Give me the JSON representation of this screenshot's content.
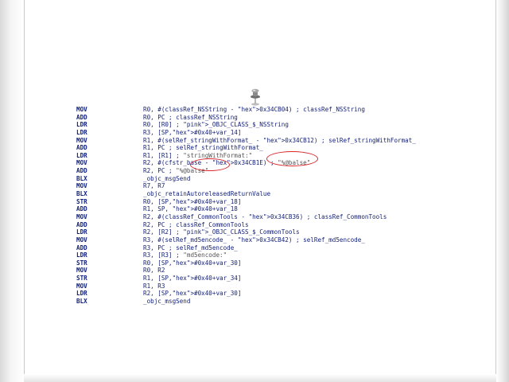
{
  "listing": [
    {
      "op": "MOV",
      "args": "R0, #(classRef_NSString - 0x34CB04) ; classRef_NSString"
    },
    {
      "op": "ADD",
      "args": "R0, PC ; classRef_NSString"
    },
    {
      "op": "LDR",
      "args": "R0, [R0] ; _OBJC_CLASS_$_NSString"
    },
    {
      "op": "LDR",
      "args": "R3, [SP,#0x40+var_14]"
    },
    {
      "op": "MOV",
      "args": "R1, #(selRef_stringWithFormat_ - 0x34CB12) ; selRef_stringWithFormat_"
    },
    {
      "op": "ADD",
      "args": "R1, PC ; selRef_stringWithFormat_"
    },
    {
      "op": "LDR",
      "args": "R1, [R1] ; \"stringWithFormat:\""
    },
    {
      "op": "MOV",
      "args": "R2, #(cfstr_base - 0x34CB1E) ; \"%@balse\""
    },
    {
      "op": "ADD",
      "args": "R2, PC ; \"%@balse\""
    },
    {
      "op": "BLX",
      "args": "_objc_msgSend"
    },
    {
      "op": "MOV",
      "args": "R7, R7"
    },
    {
      "op": "BLX",
      "args": "_objc_retainAutoreleasedReturnValue"
    },
    {
      "op": "STR",
      "args": "R0, [SP,#0x40+var_18]"
    },
    {
      "op": "ADD",
      "args": "R1, SP, #0x40+var_18"
    },
    {
      "op": "MOV",
      "args": "R2, #(classRef_CommonTools - 0x34CB36) ; classRef_CommonTools"
    },
    {
      "op": "ADD",
      "args": "R2, PC ; classRef_CommonTools"
    },
    {
      "op": "LDR",
      "args": "R2, [R2] ; _OBJC_CLASS_$_CommonTools"
    },
    {
      "op": "MOV",
      "args": "R3, #(selRef_md5encode_ - 0x34CB42) ; selRef_md5encode_"
    },
    {
      "op": "ADD",
      "args": "R3, PC ; selRef_md5encode_"
    },
    {
      "op": "LDR",
      "args": "R3, [R3] ; \"md5encode:\""
    },
    {
      "op": "STR",
      "args": "R0, [SP,#0x40+var_30]"
    },
    {
      "op": "MOV",
      "args": "R0, R2"
    },
    {
      "op": "STR",
      "args": "R1, [SP,#0x40+var_34]"
    },
    {
      "op": "MOV",
      "args": "R1, R3"
    },
    {
      "op": "LDR",
      "args": "R2, [SP,#0x40+var_30]"
    },
    {
      "op": "BLX",
      "args": "_objc_msgSend"
    }
  ],
  "colors": {
    "opcode": "#0d1f7a",
    "operand": "#16237a",
    "class_symbol": "#c02bb5",
    "hex_offset": "#1b5fd0",
    "comment_string": "#7a7a7a",
    "annotation_ring": "#d8272b"
  },
  "icons": {
    "pin": "push-pin-icon"
  }
}
